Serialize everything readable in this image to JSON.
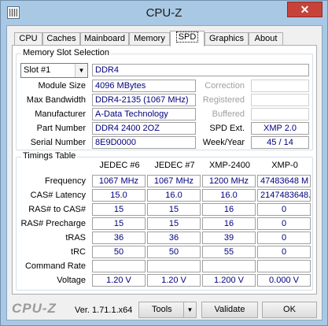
{
  "window": {
    "title": "CPU-Z",
    "close_glyph": "✕"
  },
  "tabs": [
    "CPU",
    "Caches",
    "Mainboard",
    "Memory",
    "SPD",
    "Graphics",
    "About"
  ],
  "active_tab": "SPD",
  "memory_slot": {
    "group_title": "Memory Slot Selection",
    "slot_selected": "Slot #1",
    "memory_type": "DDR4",
    "fields": {
      "module_size": {
        "label": "Module Size",
        "value": "4096 MBytes"
      },
      "max_bandwidth": {
        "label": "Max Bandwidth",
        "value": "DDR4-2135 (1067 MHz)"
      },
      "manufacturer": {
        "label": "Manufacturer",
        "value": "A-Data Technology"
      },
      "part_number": {
        "label": "Part Number",
        "value": "DDR4 2400 2OZ"
      },
      "serial_number": {
        "label": "Serial Number",
        "value": "8E9D0000"
      }
    },
    "right_fields": {
      "correction": {
        "label": "Correction",
        "value": ""
      },
      "registered": {
        "label": "Registered",
        "value": ""
      },
      "buffered": {
        "label": "Buffered",
        "value": ""
      },
      "spd_ext": {
        "label": "SPD Ext.",
        "value": "XMP 2.0"
      },
      "week_year": {
        "label": "Week/Year",
        "value": "45 / 14"
      }
    }
  },
  "timings": {
    "group_title": "Timings Table",
    "columns": [
      "JEDEC #6",
      "JEDEC #7",
      "XMP-2400",
      "XMP-0"
    ],
    "rows": [
      {
        "label": "Frequency",
        "values": [
          "1067 MHz",
          "1067 MHz",
          "1200 MHz",
          "47483648 M"
        ]
      },
      {
        "label": "CAS# Latency",
        "values": [
          "15.0",
          "16.0",
          "16.0",
          "2147483648."
        ]
      },
      {
        "label": "RAS# to CAS#",
        "values": [
          "15",
          "15",
          "16",
          "0"
        ]
      },
      {
        "label": "RAS# Precharge",
        "values": [
          "15",
          "15",
          "16",
          "0"
        ]
      },
      {
        "label": "tRAS",
        "values": [
          "36",
          "36",
          "39",
          "0"
        ]
      },
      {
        "label": "tRC",
        "values": [
          "50",
          "50",
          "55",
          "0"
        ]
      },
      {
        "label": "Command Rate",
        "values": [
          "",
          "",
          "",
          ""
        ]
      },
      {
        "label": "Voltage",
        "values": [
          "1.20 V",
          "1.20 V",
          "1.200 V",
          "0.000 V"
        ]
      }
    ]
  },
  "footer": {
    "logo": "CPU-Z",
    "version": "Ver. 1.71.1.x64",
    "tools_label": "Tools",
    "validate_label": "Validate",
    "ok_label": "OK"
  }
}
